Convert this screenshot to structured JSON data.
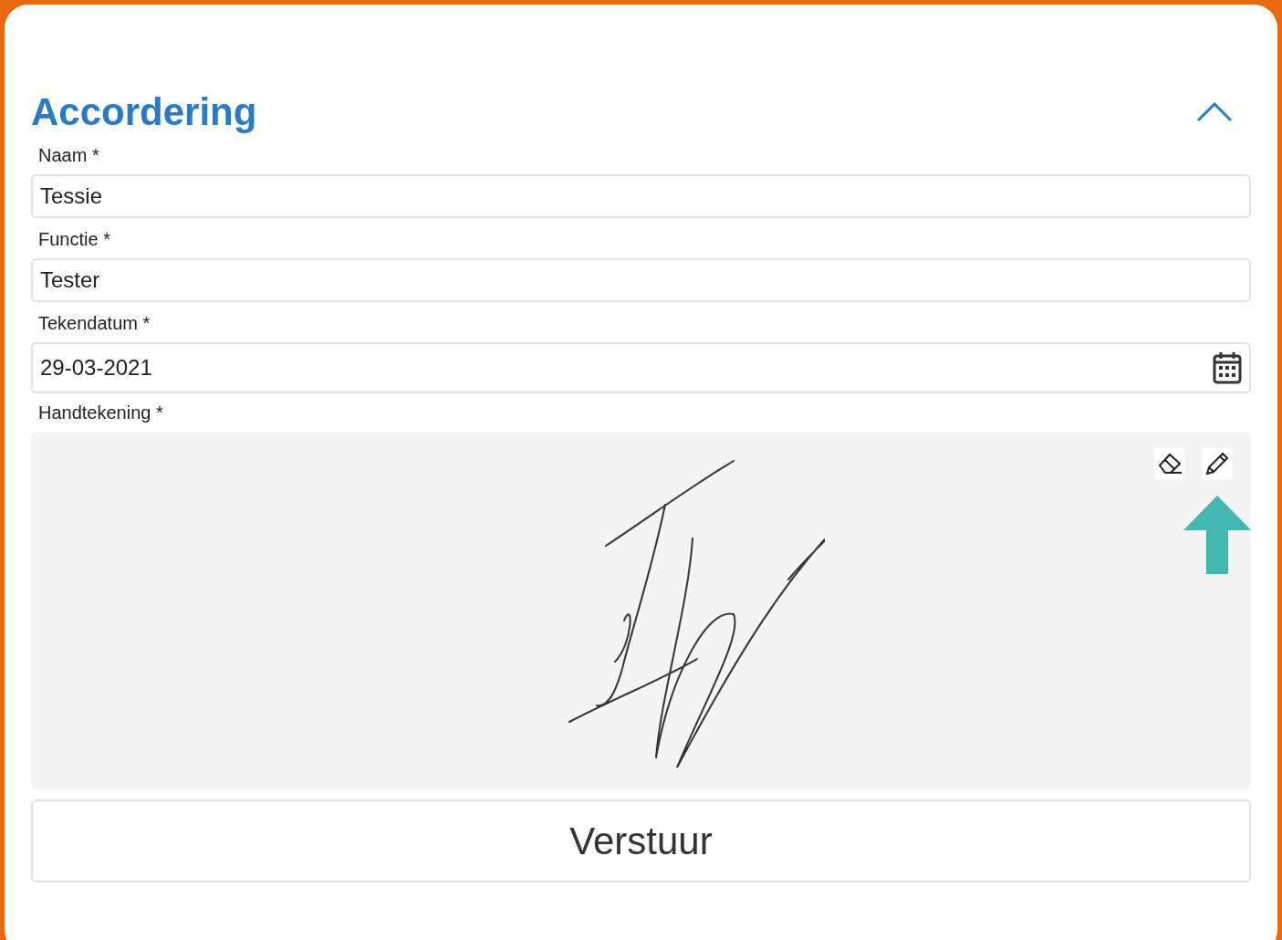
{
  "section": {
    "title": "Accordering",
    "expanded": true
  },
  "fields": [
    {
      "kind": "text",
      "label": "Naam *",
      "value": "Tessie"
    },
    {
      "kind": "text",
      "label": "Functie *",
      "value": "Tester"
    },
    {
      "kind": "date",
      "label": "Tekendatum *",
      "value": "29-03-2021"
    }
  ],
  "signature": {
    "label": "Handtekening *"
  },
  "submit": {
    "label": "Verstuur"
  }
}
